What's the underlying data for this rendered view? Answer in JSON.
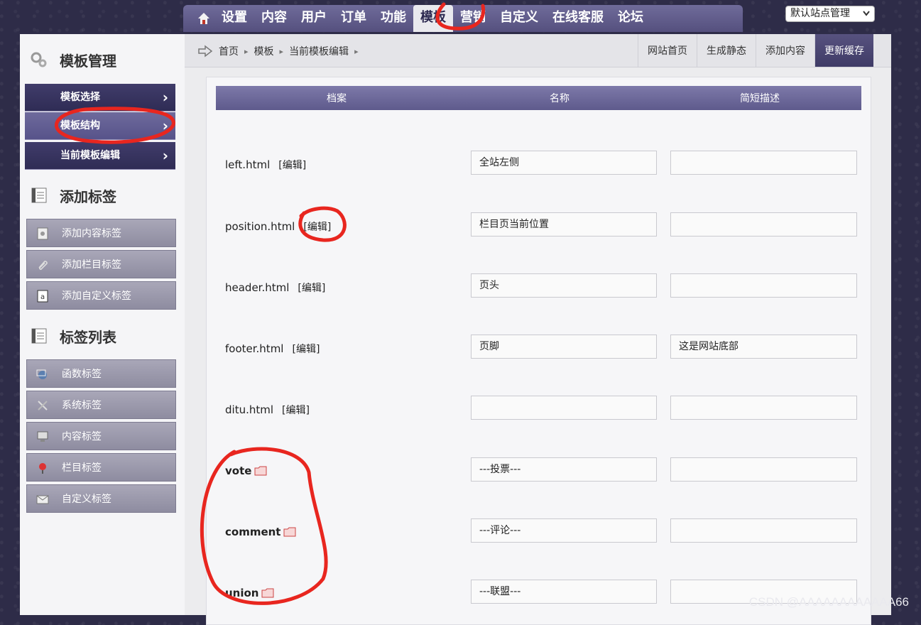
{
  "topnav": {
    "items": [
      "设置",
      "内容",
      "用户",
      "订单",
      "功能",
      "模板",
      "营销",
      "自定义",
      "在线客服",
      "论坛"
    ],
    "active_index": 5
  },
  "site_select": {
    "value": "默认站点管理"
  },
  "sidebar": {
    "sections": [
      {
        "title": "模板管理",
        "icon": "gears-icon"
      },
      {
        "title": "添加标签",
        "icon": "list-icon"
      },
      {
        "title": "标签列表",
        "icon": "list-icon"
      }
    ],
    "template_items": [
      "模板选择",
      "模板结构",
      "当前模板编辑"
    ],
    "template_selected": 1,
    "add_tag_items": [
      "添加内容标签",
      "添加栏目标签",
      "添加自定义标签"
    ],
    "tag_list_items": [
      "函数标签",
      "系统标签",
      "内容标签",
      "栏目标签",
      "自定义标签"
    ]
  },
  "breadcrumb": [
    "首页",
    "模板",
    "当前模板编辑"
  ],
  "quick_links": [
    "网站首页",
    "生成静态",
    "添加内容",
    "更新缓存"
  ],
  "table": {
    "headers": [
      "档案",
      "名称",
      "简短描述"
    ],
    "edit_label": "[编辑]",
    "rows": [
      {
        "file": "left.html",
        "name": "全站左侧",
        "desc": ""
      },
      {
        "file": "position.html",
        "name": "栏目页当前位置",
        "desc": ""
      },
      {
        "file": "header.html",
        "name": "页头",
        "desc": ""
      },
      {
        "file": "footer.html",
        "name": "页脚",
        "desc": "这是网站底部"
      },
      {
        "file": "ditu.html",
        "name": "",
        "desc": ""
      },
      {
        "file": "vote",
        "name": "---投票---",
        "desc": "",
        "folder": true
      },
      {
        "file": "comment",
        "name": "---评论---",
        "desc": "",
        "folder": true
      },
      {
        "file": "union",
        "name": "---联盟---",
        "desc": "",
        "folder": true
      }
    ]
  },
  "watermark": "CSDN @AAAAAAAAAAAA66",
  "colors": {
    "nav": "#5e5a8c",
    "annotation": "#e8261f",
    "dark_item": "#353160"
  }
}
